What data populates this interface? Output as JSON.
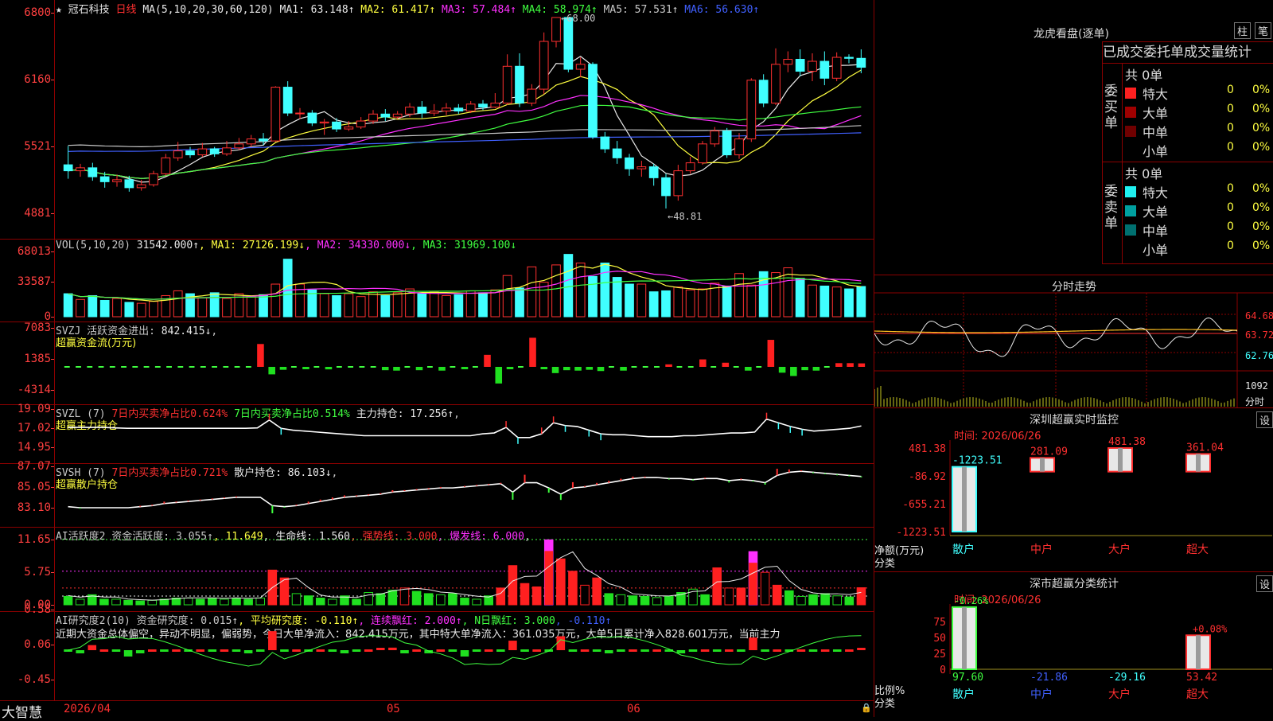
{
  "kline": {
    "star": "★",
    "name": "冠石科技",
    "period": "日线",
    "ma_label": "MA(5,10,20,30,60,120)",
    "ma": [
      {
        "label": "MA1: 63.148↑",
        "color": "#e8e8e8"
      },
      {
        "label": "MA2: 61.417↑",
        "color": "#ffff40"
      },
      {
        "label": "MA3: 57.484↑",
        "color": "#ff30ff"
      },
      {
        "label": "MA4: 58.974↑",
        "color": "#40ff40"
      },
      {
        "label": "MA5: 57.531↑",
        "color": "#c8c8c8"
      },
      {
        "label": "MA6: 56.630↑",
        "color": "#4060ff"
      }
    ],
    "y_ticks": [
      "6800",
      "6160",
      "5521",
      "4881"
    ],
    "high_label": "68.00",
    "low_label": "48.81",
    "candles": [
      {
        "o": 53.2,
        "c": 52.6,
        "h": 55.1,
        "l": 51.8
      },
      {
        "o": 52.6,
        "c": 52.9,
        "h": 53.3,
        "l": 52.0
      },
      {
        "o": 52.9,
        "c": 52.0,
        "h": 53.4,
        "l": 51.6
      },
      {
        "o": 52.0,
        "c": 51.5,
        "h": 52.5,
        "l": 50.9
      },
      {
        "o": 51.5,
        "c": 51.7,
        "h": 52.2,
        "l": 51.0
      },
      {
        "o": 51.7,
        "c": 50.9,
        "h": 52.1,
        "l": 50.5
      },
      {
        "o": 50.9,
        "c": 51.2,
        "h": 51.7,
        "l": 50.6
      },
      {
        "o": 51.2,
        "c": 52.3,
        "h": 52.6,
        "l": 51.0
      },
      {
        "o": 52.3,
        "c": 53.9,
        "h": 54.3,
        "l": 52.1
      },
      {
        "o": 53.9,
        "c": 54.6,
        "h": 55.5,
        "l": 53.6
      },
      {
        "o": 54.6,
        "c": 54.2,
        "h": 55.0,
        "l": 53.9
      },
      {
        "o": 54.2,
        "c": 54.8,
        "h": 55.4,
        "l": 54.0
      },
      {
        "o": 54.8,
        "c": 54.3,
        "h": 55.0,
        "l": 54.0
      },
      {
        "o": 54.3,
        "c": 54.9,
        "h": 55.6,
        "l": 54.1
      },
      {
        "o": 54.9,
        "c": 55.3,
        "h": 55.9,
        "l": 54.7
      },
      {
        "o": 55.3,
        "c": 55.8,
        "h": 56.2,
        "l": 55.0
      },
      {
        "o": 55.8,
        "c": 55.6,
        "h": 56.4,
        "l": 55.2
      },
      {
        "o": 55.6,
        "c": 61.0,
        "h": 61.1,
        "l": 55.5
      },
      {
        "o": 61.0,
        "c": 58.4,
        "h": 61.6,
        "l": 58.1
      },
      {
        "o": 58.4,
        "c": 58.4,
        "h": 58.9,
        "l": 57.8
      },
      {
        "o": 58.4,
        "c": 57.4,
        "h": 58.7,
        "l": 57.1
      },
      {
        "o": 57.4,
        "c": 57.5,
        "h": 57.8,
        "l": 56.2
      },
      {
        "o": 57.5,
        "c": 56.8,
        "h": 57.9,
        "l": 56.5
      },
      {
        "o": 56.8,
        "c": 57.0,
        "h": 57.6,
        "l": 56.6
      },
      {
        "o": 57.0,
        "c": 57.6,
        "h": 58.0,
        "l": 56.8
      },
      {
        "o": 57.6,
        "c": 58.3,
        "h": 58.7,
        "l": 57.3
      },
      {
        "o": 58.3,
        "c": 58.0,
        "h": 58.8,
        "l": 57.6
      },
      {
        "o": 58.0,
        "c": 58.3,
        "h": 58.6,
        "l": 57.8
      },
      {
        "o": 58.3,
        "c": 59.0,
        "h": 59.4,
        "l": 58.0
      },
      {
        "o": 59.0,
        "c": 58.4,
        "h": 59.6,
        "l": 57.9
      },
      {
        "o": 58.4,
        "c": 58.6,
        "h": 59.3,
        "l": 58.1
      },
      {
        "o": 58.6,
        "c": 58.9,
        "h": 59.4,
        "l": 58.2
      },
      {
        "o": 58.9,
        "c": 58.6,
        "h": 59.3,
        "l": 58.3
      },
      {
        "o": 58.6,
        "c": 59.3,
        "h": 59.6,
        "l": 58.4
      },
      {
        "o": 59.3,
        "c": 59.0,
        "h": 59.7,
        "l": 58.7
      },
      {
        "o": 59.0,
        "c": 59.4,
        "h": 60.4,
        "l": 58.9
      },
      {
        "o": 59.4,
        "c": 63.1,
        "h": 64.3,
        "l": 59.2
      },
      {
        "o": 63.1,
        "c": 59.4,
        "h": 64.4,
        "l": 59.0
      },
      {
        "o": 59.4,
        "c": 60.8,
        "h": 61.3,
        "l": 59.1
      },
      {
        "o": 60.8,
        "c": 65.6,
        "h": 66.5,
        "l": 60.3
      },
      {
        "o": 65.6,
        "c": 68.0,
        "h": 68.0,
        "l": 65.0
      },
      {
        "o": 68.0,
        "c": 62.8,
        "h": 68.0,
        "l": 62.5
      },
      {
        "o": 62.8,
        "c": 63.3,
        "h": 64.0,
        "l": 62.0
      },
      {
        "o": 63.3,
        "c": 56.0,
        "h": 63.5,
        "l": 55.8
      },
      {
        "o": 56.0,
        "c": 54.8,
        "h": 56.5,
        "l": 54.4
      },
      {
        "o": 54.8,
        "c": 53.9,
        "h": 55.6,
        "l": 53.3
      },
      {
        "o": 53.9,
        "c": 52.8,
        "h": 54.3,
        "l": 52.1
      },
      {
        "o": 52.8,
        "c": 53.0,
        "h": 53.6,
        "l": 52.0
      },
      {
        "o": 53.0,
        "c": 51.9,
        "h": 53.3,
        "l": 51.1
      },
      {
        "o": 51.9,
        "c": 50.1,
        "h": 52.3,
        "l": 48.81
      },
      {
        "o": 50.1,
        "c": 52.6,
        "h": 53.2,
        "l": 49.6
      },
      {
        "o": 52.6,
        "c": 53.4,
        "h": 54.0,
        "l": 52.3
      },
      {
        "o": 53.4,
        "c": 55.3,
        "h": 55.6,
        "l": 53.2
      },
      {
        "o": 55.3,
        "c": 56.6,
        "h": 57.0,
        "l": 55.0
      },
      {
        "o": 56.6,
        "c": 54.2,
        "h": 56.9,
        "l": 53.9
      },
      {
        "o": 54.2,
        "c": 55.8,
        "h": 56.4,
        "l": 53.8
      },
      {
        "o": 55.8,
        "c": 61.7,
        "h": 61.9,
        "l": 55.5
      },
      {
        "o": 61.7,
        "c": 59.4,
        "h": 62.3,
        "l": 59.0
      },
      {
        "o": 59.4,
        "c": 63.3,
        "h": 64.9,
        "l": 59.2
      },
      {
        "o": 63.3,
        "c": 63.8,
        "h": 64.6,
        "l": 62.5
      },
      {
        "o": 63.8,
        "c": 62.6,
        "h": 64.8,
        "l": 62.1
      },
      {
        "o": 62.6,
        "c": 63.6,
        "h": 64.4,
        "l": 61.6
      },
      {
        "o": 63.6,
        "c": 61.9,
        "h": 64.6,
        "l": 61.2
      },
      {
        "o": 61.9,
        "c": 64.0,
        "h": 64.5,
        "l": 61.6
      },
      {
        "o": 64.0,
        "c": 63.9,
        "h": 64.3,
        "l": 63.4
      },
      {
        "o": 63.9,
        "c": 63.0,
        "h": 64.8,
        "l": 62.4
      }
    ]
  },
  "vol": {
    "header": [
      {
        "t": "VOL(5,10,20) ",
        "c": "#c8c8c8"
      },
      {
        "t": "31542.000↑",
        "c": "#e8e8e8"
      },
      {
        "t": ", MA1: 27126.199↓",
        "c": "#ffff40"
      },
      {
        "t": ", MA2: 34330.000↓",
        "c": "#ff30ff"
      },
      {
        "t": ", MA3: 31969.100↓",
        "c": "#40ff40"
      }
    ],
    "y_ticks": [
      "68013",
      "33587",
      "0"
    ],
    "values": [
      24000,
      18000,
      22000,
      17000,
      19000,
      15000,
      14000,
      16000,
      22000,
      27000,
      24000,
      20000,
      25000,
      19000,
      24000,
      21000,
      23000,
      34000,
      60000,
      34000,
      28000,
      24000,
      22000,
      24000,
      21000,
      26000,
      22000,
      25000,
      29000,
      24000,
      26000,
      22000,
      23000,
      27000,
      25000,
      28000,
      43000,
      30000,
      52000,
      36000,
      54000,
      65000,
      56000,
      42000,
      56000,
      41000,
      34000,
      34000,
      26000,
      27000,
      31000,
      28000,
      29000,
      35000,
      32000,
      45000,
      33000,
      47000,
      46000,
      51000,
      40000,
      33000,
      32000,
      31000,
      29000,
      31542
    ]
  },
  "svzj": {
    "header": [
      {
        "t": "SVZJ  活跃资金进出: ",
        "c": "#c8c8c8"
      },
      {
        "t": "842.415↓",
        "c": "#e8e8e8"
      },
      {
        "t": ",",
        "c": "#c8c8c8"
      }
    ],
    "sub": "超赢资金流(万元)",
    "y_ticks": [
      "7083",
      "1385",
      "-4314"
    ],
    "values": [
      0,
      0,
      0,
      0,
      0,
      0,
      0,
      0,
      0,
      0,
      0,
      0,
      0,
      0,
      0,
      0,
      0,
      5500,
      -1800,
      -700,
      0,
      -300,
      0,
      -600,
      0,
      0,
      0,
      0,
      -800,
      -900,
      0,
      -800,
      0,
      -900,
      0,
      -400,
      0,
      2900,
      -4000,
      -400,
      0,
      7000,
      -300,
      -1500,
      -800,
      -900,
      -700,
      -1000,
      0,
      -900,
      0,
      0,
      0,
      600,
      0,
      0,
      1800,
      0,
      1000,
      0,
      -900,
      0,
      6500,
      -1400,
      -2200,
      -800,
      -900,
      0,
      900,
      900,
      842
    ]
  },
  "svzl": {
    "header": [
      {
        "t": "SVZL (7) ",
        "c": "#c8c8c8"
      },
      {
        "t": "7日内买卖净占比0.624%",
        "c": "#ff3030"
      },
      {
        "t": " 7日内买卖净占比0.514%",
        "c": "#40ff40"
      },
      {
        "t": " 主力持仓: 17.256↑",
        "c": "#e8e8e8"
      },
      {
        "t": ",",
        "c": "#c8c8c8"
      }
    ],
    "sub": "超赢主力持仓",
    "y_ticks": [
      "19.09",
      "17.02",
      "14.95"
    ],
    "values": [
      17.1,
      17.1,
      17.1,
      17.1,
      17.05,
      17.0,
      17.0,
      17.0,
      17.0,
      17.0,
      17.0,
      17.0,
      17.0,
      17.0,
      17.0,
      17.0,
      17.05,
      17.9,
      17.0,
      16.8,
      16.7,
      16.6,
      16.5,
      16.4,
      16.3,
      16.2,
      16.2,
      16.2,
      16.2,
      16.2,
      16.2,
      16.2,
      16.2,
      16.2,
      16.2,
      16.4,
      16.5,
      17.1,
      16.0,
      16.0,
      16.4,
      17.6,
      17.3,
      17.2,
      16.8,
      16.4,
      16.3,
      16.3,
      16.2,
      16.1,
      16.1,
      16.1,
      16.2,
      16.2,
      16.3,
      16.4,
      16.5,
      16.5,
      16.6,
      18.0,
      17.6,
      17.2,
      16.9,
      16.7,
      16.8,
      16.9,
      17.0,
      17.256
    ]
  },
  "svsh": {
    "header": [
      {
        "t": "SVSH (7) ",
        "c": "#c8c8c8"
      },
      {
        "t": "7日内买卖净占比0.721%",
        "c": "#ff3030"
      },
      {
        "t": " 散户持仓: 86.103↓",
        "c": "#e8e8e8"
      },
      {
        "t": ",",
        "c": "#c8c8c8"
      }
    ],
    "sub": "超赢散户持仓",
    "y_ticks": [
      "87.07",
      "85.05",
      "83.10"
    ],
    "values": [
      83.2,
      83.1,
      83.1,
      83.1,
      83.1,
      83.1,
      83.2,
      83.3,
      83.5,
      83.6,
      83.7,
      83.8,
      83.9,
      84.0,
      84.1,
      84.1,
      84.1,
      83.3,
      83.2,
      83.3,
      83.5,
      83.7,
      83.9,
      84.1,
      84.2,
      84.3,
      84.4,
      84.6,
      84.7,
      84.8,
      84.9,
      85.0,
      85.0,
      85.1,
      85.2,
      85.3,
      85.4,
      84.6,
      85.5,
      85.5,
      85.0,
      84.4,
      85.0,
      85.1,
      85.3,
      85.5,
      85.7,
      85.9,
      86.0,
      86.0,
      85.9,
      85.9,
      85.8,
      85.9,
      85.9,
      85.7,
      85.8,
      85.7,
      85.5,
      86.2,
      86.5,
      86.6,
      86.5,
      86.4,
      86.3,
      86.2,
      86.103
    ]
  },
  "ai1": {
    "header": [
      {
        "t": "AI活跃度2 资金活跃度: 3.055↑",
        "c": "#c8c8c8"
      },
      {
        "t": ", 11.649",
        "c": "#ffff40"
      },
      {
        "t": ", 生命线: 1.560",
        "c": "#e8e8e8"
      },
      {
        "t": ", 强势线: 3.000",
        "c": "#ff3030"
      },
      {
        "t": ", 爆发线: 6.000",
        "c": "#ff30ff"
      },
      {
        "t": ",",
        "c": "#c8c8c8"
      }
    ],
    "y_ticks": [
      "11.65",
      "5.75",
      "0.00"
    ],
    "values": [
      1.5,
      1.0,
      1.8,
      1.0,
      1.0,
      0.8,
      0.7,
      0.8,
      1.0,
      1.2,
      1.2,
      1.0,
      1.2,
      1.0,
      1.2,
      1.0,
      1.2,
      6.2,
      4.8,
      2.0,
      1.6,
      1.2,
      1.0,
      1.6,
      1.0,
      2.2,
      2.0,
      2.6,
      3.0,
      2.4,
      2.0,
      1.8,
      2.0,
      1.2,
      1.0,
      1.6,
      3.0,
      7.0,
      3.8,
      3.2,
      11.6,
      8.2,
      6.0,
      3.5,
      4.8,
      2.0,
      1.8,
      1.6,
      1.5,
      1.3,
      1.5,
      2.2,
      2.8,
      1.8,
      6.6,
      3.0,
      3.0,
      9.5,
      5.8,
      3.5,
      2.5,
      1.5,
      1.8,
      2.0,
      1.6,
      1.4,
      3.055
    ]
  },
  "ai2": {
    "header": [
      {
        "t": "AI研究度2(10) 资金研究度: 0.015↑",
        "c": "#c8c8c8"
      },
      {
        "t": ", 平均研究度: -0.110↑",
        "c": "#ffff40"
      },
      {
        "t": ", 连续飘红: 2.000↑",
        "c": "#ff30ff"
      },
      {
        "t": ", N日飘红: 3.000",
        "c": "#40ff40"
      },
      {
        "t": ", -0.110↑",
        "c": "#4060ff"
      }
    ],
    "comment": "近期大资金总体偏空，异动不明显，偏弱势，今日大单净流入：842.415万元，其中特大单净流入：361.035万元，大单5日累计净入828.601万元，当前主力",
    "y_ticks": [
      "0.58",
      "0.06",
      "-0.45"
    ],
    "values": [
      0,
      -0.05,
      0.08,
      0,
      0,
      -0.1,
      -0.05,
      0,
      0,
      0,
      0,
      0,
      0,
      0,
      0,
      -0.05,
      0,
      0.3,
      0,
      0,
      0,
      0,
      0,
      -0.05,
      0,
      0,
      0.02,
      0.04,
      -0.05,
      0,
      -0.05,
      0,
      0,
      -0.1,
      0,
      0,
      0,
      0.15,
      0,
      0,
      0,
      0.22,
      0,
      0,
      0,
      -0.05,
      0,
      0,
      0,
      0,
      0,
      -0.05,
      0,
      0,
      0,
      0,
      0,
      0.2,
      0,
      0,
      0,
      0,
      0,
      0,
      0,
      0,
      0.015
    ]
  },
  "xaxis": {
    "brand": "大智慧",
    "labels": [
      "2026/04",
      "05",
      "06"
    ]
  },
  "rank": {
    "title": "龙虎看盘(逐单)",
    "btn1": "柱",
    "btn2": "笔",
    "subtitle": "已成交委托单成交量统计",
    "buy_label": "委买单",
    "sell_label": "委卖单",
    "buy_total": "共 0单",
    "sell_total": "共 0单",
    "buy_rows": [
      {
        "name": "特大",
        "v": "0",
        "p": "0%",
        "color": "#ff2020"
      },
      {
        "name": "大单",
        "v": "0",
        "p": "0%",
        "color": "#a00000"
      },
      {
        "name": "中单",
        "v": "0",
        "p": "0%",
        "color": "#700000"
      },
      {
        "name": "小单",
        "v": "0",
        "p": "0%",
        "color": "#000000"
      }
    ],
    "sell_rows": [
      {
        "name": "特大",
        "v": "0",
        "p": "0%",
        "color": "#20f0f0"
      },
      {
        "name": "大单",
        "v": "0",
        "p": "0%",
        "color": "#00a0a0"
      },
      {
        "name": "中单",
        "v": "0",
        "p": "0%",
        "color": "#007070"
      },
      {
        "name": "小单",
        "v": "0",
        "p": "0%",
        "color": "#000000"
      }
    ]
  },
  "intraday": {
    "title": "分时走势",
    "p_hi": "64.68",
    "p_mid": "63.72",
    "p_lo": "62.76",
    "vol_top": "1092",
    "vol_unit": "分时"
  },
  "monitor": {
    "title": "深圳超赢实时监控",
    "btn": "设",
    "time": "时间: 2026/06/26",
    "y_ticks": [
      "481.38",
      "-86.92",
      "-655.21",
      "-1223.51"
    ],
    "ylabel1": "净额(万元)",
    "ylabel2": "分类",
    "cats": [
      "散户",
      "中户",
      "大户",
      "超大"
    ],
    "values": [
      -1223.51,
      281.09,
      481.38,
      361.04
    ],
    "labels": [
      "-1223.51",
      "281.09",
      "481.38",
      "361.04"
    ]
  },
  "classify": {
    "title": "深市超赢分类统计",
    "btn": "设",
    "time": "时间: 2026/06/26",
    "y_ticks": [
      "75",
      "50",
      "25",
      "0"
    ],
    "ylabel1": "比例%",
    "ylabel2": "分类",
    "cats": [
      "散户",
      "中户",
      "大户",
      "超大"
    ],
    "values": [
      97.6,
      -21.86,
      -29.16,
      53.42
    ],
    "labels": [
      "97.60",
      "-21.86",
      "-29.16",
      "53.42"
    ],
    "top_labels": [
      "-0.26%",
      "+0.08%"
    ]
  }
}
